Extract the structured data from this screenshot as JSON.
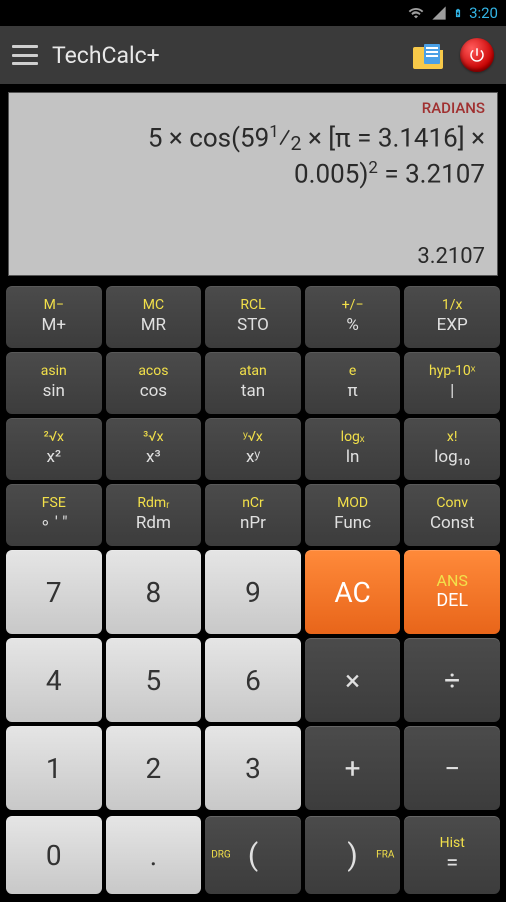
{
  "status": {
    "time": "3:20"
  },
  "header": {
    "title": "TechCalc+"
  },
  "display": {
    "mode": "RADIANS",
    "expr_line1": "5 × cos(59½ × [π = 3.1416] ×",
    "expr_line2": "0.005)² = 3.2107",
    "result": "3.2107"
  },
  "func_rows": [
    [
      {
        "sec": "M−",
        "pri": "M+"
      },
      {
        "sec": "MC",
        "pri": "MR"
      },
      {
        "sec": "RCL",
        "pri": "STO"
      },
      {
        "sec": "+/−",
        "pri": "%"
      },
      {
        "sec": "1/x",
        "pri": "EXP"
      }
    ],
    [
      {
        "sec": "asin",
        "pri": "sin"
      },
      {
        "sec": "acos",
        "pri": "cos"
      },
      {
        "sec": "atan",
        "pri": "tan"
      },
      {
        "sec": "e",
        "pri": "π"
      },
      {
        "sec": "hyp-10ˣ",
        "pri": "|"
      }
    ],
    [
      {
        "sec": "²√x",
        "pri": "x²"
      },
      {
        "sec": "³√x",
        "pri": "x³"
      },
      {
        "sec": "ʸ√x",
        "pri": "xʸ"
      },
      {
        "sec": "logₓ",
        "pri": "ln"
      },
      {
        "sec": "x!",
        "pri": "log₁₀"
      }
    ],
    [
      {
        "sec": "FSE",
        "pri": "∘ ′ ″"
      },
      {
        "sec": "Rdmᵣ",
        "pri": "Rdm"
      },
      {
        "sec": "nCr",
        "pri": "nPr"
      },
      {
        "sec": "MOD",
        "pri": "Func"
      },
      {
        "sec": "Conv",
        "pri": "Const"
      }
    ]
  ],
  "numpad": {
    "ac": "AC",
    "ans": "ANS",
    "del": "DEL",
    "d7": "7",
    "d8": "8",
    "d9": "9",
    "d4": "4",
    "d5": "5",
    "d6": "6",
    "d1": "1",
    "d2": "2",
    "d3": "3",
    "d0": "0",
    "dot": ".",
    "mul": "×",
    "div": "÷",
    "plus": "+",
    "minus": "−"
  },
  "bottom": {
    "drg": "DRG",
    "open": "(",
    "close": ")",
    "fra": "FRA",
    "hist_sec": "Hist",
    "hist_pri": "="
  }
}
